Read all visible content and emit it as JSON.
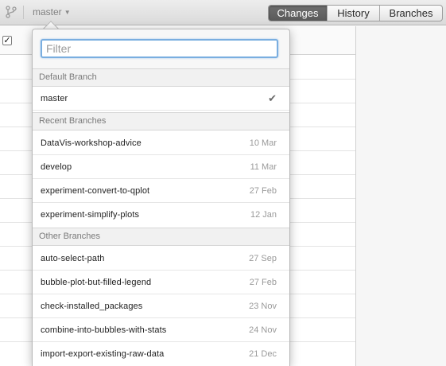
{
  "toolbar": {
    "current_branch": "master",
    "caret_icon": "chevron-down-icon",
    "branch_icon": "git-branch-icon",
    "tabs": [
      {
        "label": "Changes",
        "active": true
      },
      {
        "label": "History",
        "active": false
      },
      {
        "label": "Branches",
        "active": false
      }
    ]
  },
  "branch_popover": {
    "filter": {
      "placeholder": "Filter",
      "value": ""
    },
    "sections": [
      {
        "title": "Default Branch"
      },
      {
        "title": "Recent Branches"
      },
      {
        "title": "Other Branches"
      }
    ],
    "default_branch": {
      "name": "master",
      "checked_icon": "checkmark-icon"
    },
    "recent_branches": [
      {
        "name": "DataVis-workshop-advice",
        "date": "10 Mar"
      },
      {
        "name": "develop",
        "date": "11 Mar"
      },
      {
        "name": "experiment-convert-to-qplot",
        "date": "27 Feb"
      },
      {
        "name": "experiment-simplify-plots",
        "date": "12 Jan"
      }
    ],
    "other_branches": [
      {
        "name": "auto-select-path",
        "date": "27 Sep"
      },
      {
        "name": "bubble-plot-but-filled-legend",
        "date": "27 Feb"
      },
      {
        "name": "check-installed_packages",
        "date": "23 Nov"
      },
      {
        "name": "combine-into-bubbles-with-stats",
        "date": "24 Nov"
      },
      {
        "name": "import-export-existing-raw-data",
        "date": "21 Dec"
      }
    ]
  },
  "colors": {
    "active_tab": "#5f5f5f",
    "filter_focus": "#7aaee0"
  }
}
